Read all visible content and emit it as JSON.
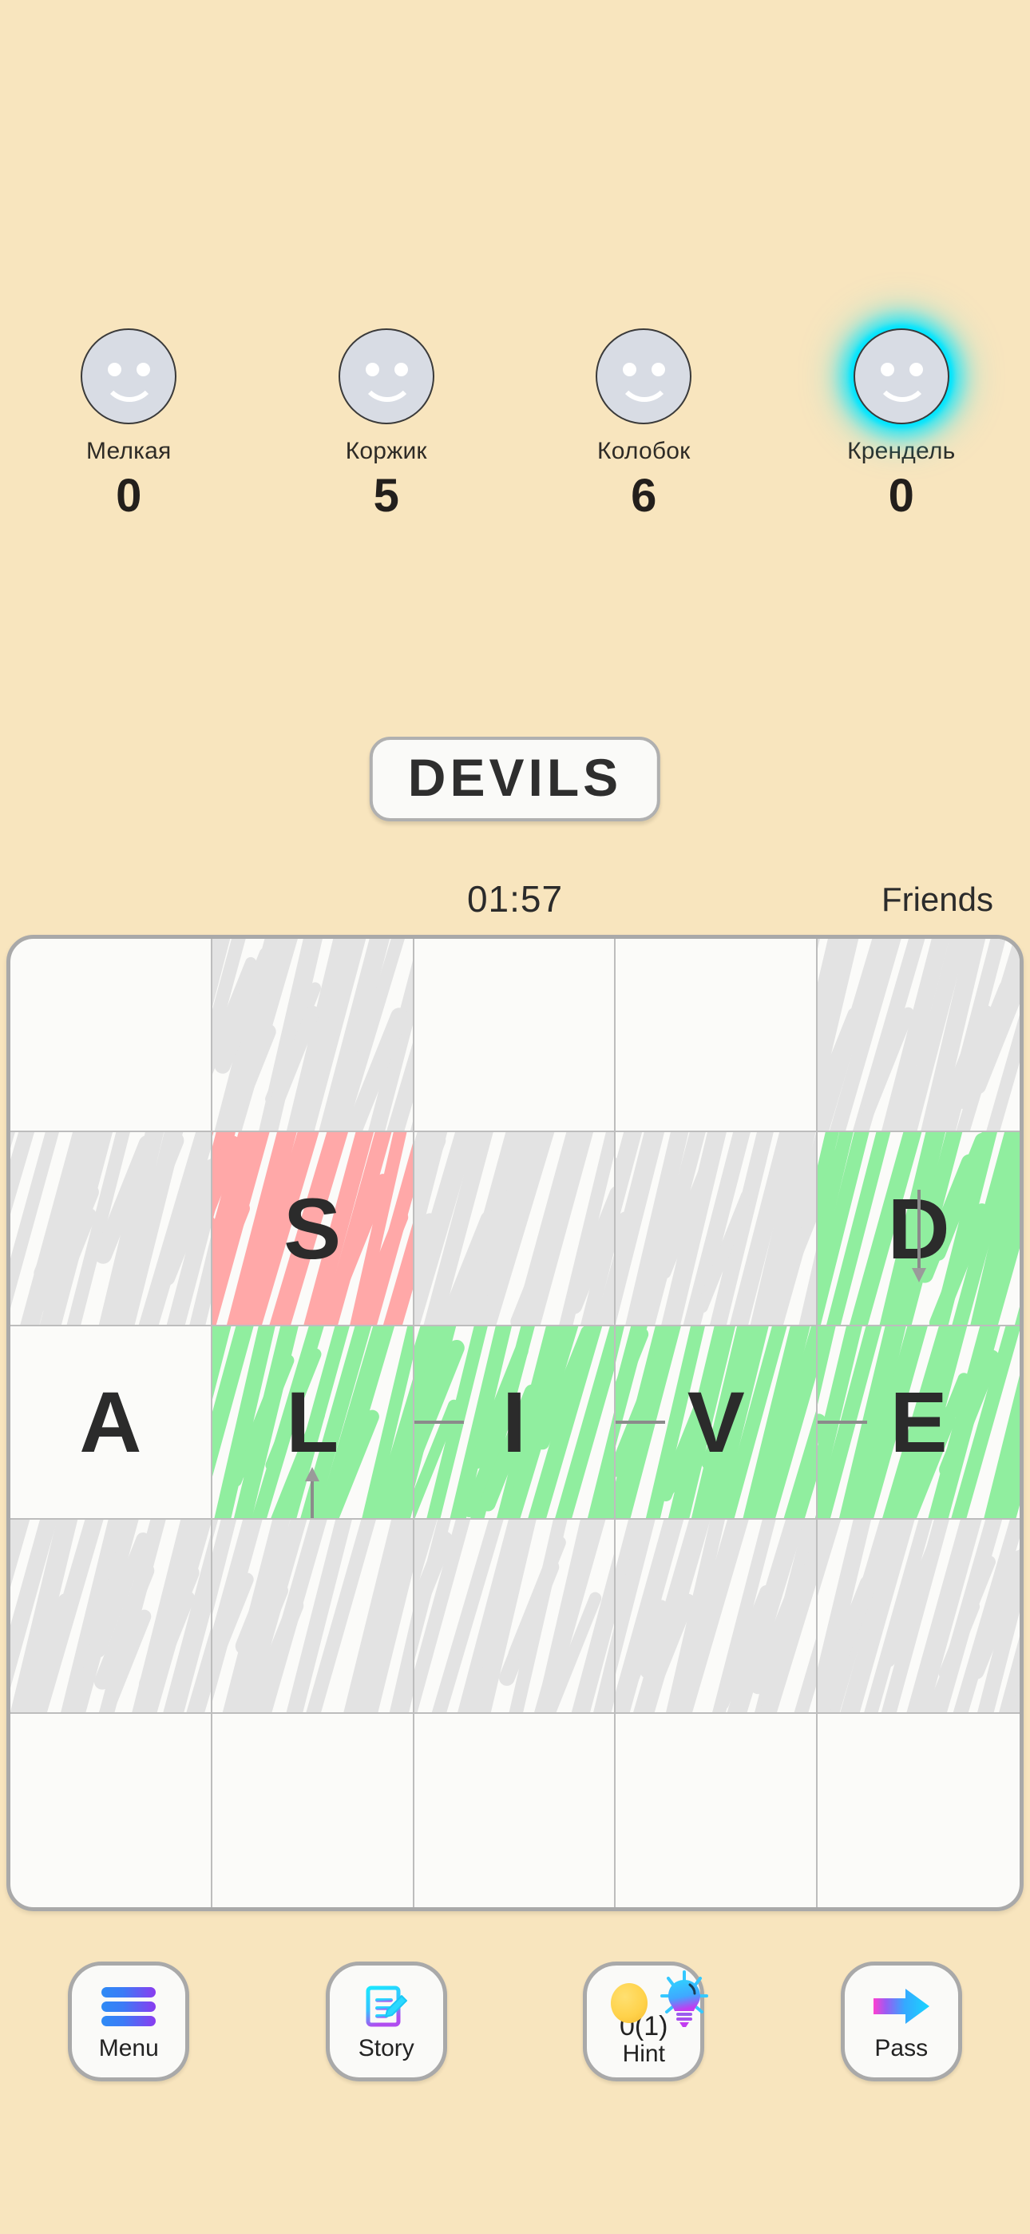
{
  "theme": {
    "background": "#F8E5BE",
    "accent_cyan": "#00E5FF",
    "scribble_gray": "#E3E3E3",
    "scribble_green": "#90EE9F",
    "scribble_red": "#FFA8A8",
    "text_dark": "#2B2B2B"
  },
  "players": [
    {
      "name": "Мелкая",
      "score": "0",
      "avatar": "smiley-face-avatar",
      "active": false
    },
    {
      "name": "Коржик",
      "score": "5",
      "avatar": "smiley-face-avatar",
      "active": false
    },
    {
      "name": "Колобок",
      "score": "6",
      "avatar": "smiley-face-avatar",
      "active": false
    },
    {
      "name": "Крендель",
      "score": "0",
      "avatar": "smiley-face-avatar",
      "active": true
    }
  ],
  "word": {
    "text": "DEVILS"
  },
  "status": {
    "timer": "01:57",
    "mode": "Friends"
  },
  "grid": {
    "rows": 5,
    "cols": 5,
    "cells": [
      [
        {
          "letter": "",
          "fill": "none"
        },
        {
          "letter": "",
          "fill": "gray"
        },
        {
          "letter": "",
          "fill": "none"
        },
        {
          "letter": "",
          "fill": "none"
        },
        {
          "letter": "",
          "fill": "gray"
        }
      ],
      [
        {
          "letter": "",
          "fill": "gray"
        },
        {
          "letter": "S",
          "fill": "red"
        },
        {
          "letter": "",
          "fill": "gray"
        },
        {
          "letter": "",
          "fill": "gray"
        },
        {
          "letter": "D",
          "fill": "green"
        }
      ],
      [
        {
          "letter": "A",
          "fill": "none"
        },
        {
          "letter": "L",
          "fill": "green"
        },
        {
          "letter": "I",
          "fill": "green"
        },
        {
          "letter": "V",
          "fill": "green"
        },
        {
          "letter": "E",
          "fill": "green"
        }
      ],
      [
        {
          "letter": "",
          "fill": "gray"
        },
        {
          "letter": "",
          "fill": "gray"
        },
        {
          "letter": "",
          "fill": "gray"
        },
        {
          "letter": "",
          "fill": "gray"
        },
        {
          "letter": "",
          "fill": "gray"
        }
      ],
      [
        {
          "letter": "",
          "fill": "none"
        },
        {
          "letter": "",
          "fill": "none"
        },
        {
          "letter": "",
          "fill": "none"
        },
        {
          "letter": "",
          "fill": "none"
        },
        {
          "letter": "",
          "fill": "none"
        }
      ]
    ],
    "arrows": [
      {
        "from_cell": "r3c2",
        "direction": "up",
        "name": "arrow-up-l-to-s"
      },
      {
        "from_cell": "r2c5",
        "direction": "down",
        "name": "arrow-down-d-to-e"
      },
      {
        "from_cell": "r3c3",
        "direction": "left",
        "name": "arrow-left-i-to-l"
      },
      {
        "from_cell": "r3c4",
        "direction": "left",
        "name": "arrow-left-v-to-i"
      },
      {
        "from_cell": "r3c5",
        "direction": "left",
        "name": "arrow-left-e-to-v"
      }
    ]
  },
  "bottom_bar": {
    "menu": {
      "label": "Menu",
      "icon": "hamburger-menu-icon"
    },
    "story": {
      "label": "Story",
      "icon": "document-pencil-icon"
    },
    "hint": {
      "count": "0(1)",
      "label": "Hint",
      "icon": "lightbulb-icon",
      "coin_icon": "coin-icon"
    },
    "pass": {
      "label": "Pass",
      "icon": "arrow-right-icon"
    }
  }
}
